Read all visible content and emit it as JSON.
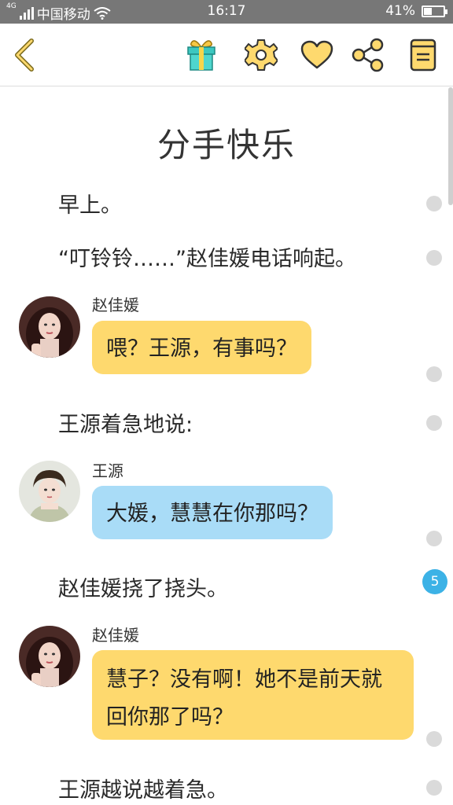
{
  "status_bar": {
    "carrier": "中国移动",
    "network": "4G",
    "time": "16:17",
    "battery": "41%",
    "battery_level": 0.41
  },
  "toolbar": {
    "icons": [
      "back-chevron-icon",
      "gift-icon",
      "gear-icon",
      "heart-icon",
      "share-icon",
      "book-icon"
    ],
    "accent_color": "#fed96e"
  },
  "chapter": {
    "title": "分手快乐"
  },
  "story": {
    "p1": "早上。",
    "p2": "“叮铃铃……”赵佳媛电话响起。",
    "msg1": {
      "speaker": "赵佳媛",
      "text": "喂？王源，有事吗？"
    },
    "p3": "王源着急地说:",
    "msg2": {
      "speaker": "王源",
      "text": "大媛，慧慧在你那吗？"
    },
    "p4": "赵佳媛挠了挠头。",
    "comment_count": "5",
    "msg3": {
      "speaker": "赵佳媛",
      "line1": "慧子？没有啊！她不是前天就",
      "line2": "回你那了吗？"
    },
    "p5": "王源越说越着急。"
  },
  "colors": {
    "yellow_bubble": "#fed96e",
    "blue_bubble": "#a9dcf7",
    "badge": "#3cb2e6",
    "status_bar": "#777777"
  }
}
